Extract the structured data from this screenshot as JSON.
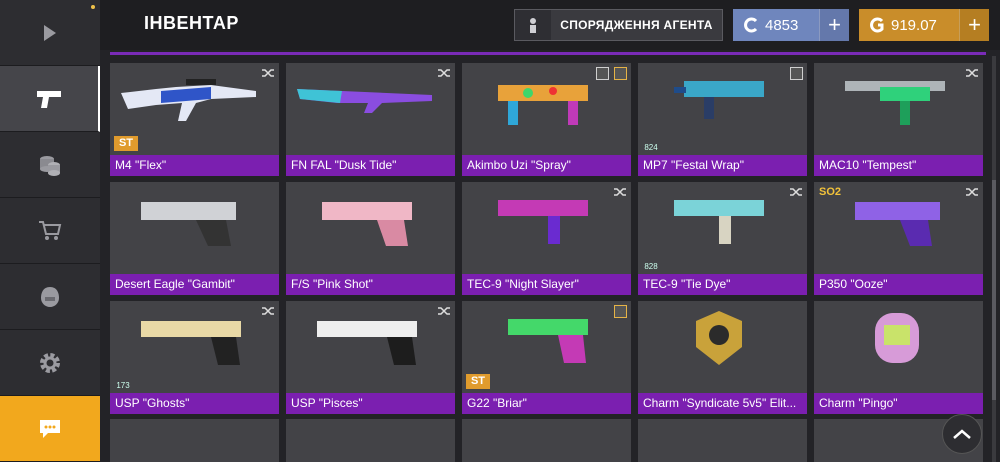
{
  "header": {
    "title": "ІНВЕНТАР",
    "agent_button": "СПОРЯДЖЕННЯ АГЕНТА",
    "cp_amount": "4853",
    "credits_amount": "919.07",
    "plus_label": "+"
  },
  "sidebar": {
    "items": [
      {
        "icon": "play-icon",
        "active": false
      },
      {
        "icon": "pistol-icon",
        "active": true
      },
      {
        "icon": "coins-icon",
        "active": false
      },
      {
        "icon": "cart-icon",
        "active": false
      },
      {
        "icon": "helmet-icon",
        "active": false
      },
      {
        "icon": "gear-icon",
        "active": false
      },
      {
        "icon": "chat-icon",
        "active": false
      }
    ]
  },
  "inventory": {
    "items": [
      {
        "name": "M4 \"Flex\"",
        "badge": "ST"
      },
      {
        "name": "FN FAL \"Dusk Tide\""
      },
      {
        "name": "Akimbo Uzi \"Spray\""
      },
      {
        "name": "MP7 \"Festal Wrap\"",
        "level": "824"
      },
      {
        "name": "MAC10 \"Tempest\""
      },
      {
        "name": "Desert Eagle \"Gambit\""
      },
      {
        "name": "F/S \"Pink Shot\""
      },
      {
        "name": "TEC-9 \"Night Slayer\""
      },
      {
        "name": "TEC-9 \"Tie Dye\"",
        "level": "828"
      },
      {
        "name": "P350 \"Ooze\"",
        "badge": "SO2"
      },
      {
        "name": "USP \"Ghosts\"",
        "level": "173"
      },
      {
        "name": "USP \"Pisces\""
      },
      {
        "name": "G22 \"Briar\"",
        "badge": "ST"
      },
      {
        "name": "Charm \"Syndicate 5v5\" Elit..."
      },
      {
        "name": "Charm \"Pingo\""
      }
    ]
  },
  "colors": {
    "accent_purple": "#7b1fb0",
    "gold": "#c98d2a",
    "blue": "#6f86bd",
    "st_badge": "#e09b2d"
  }
}
